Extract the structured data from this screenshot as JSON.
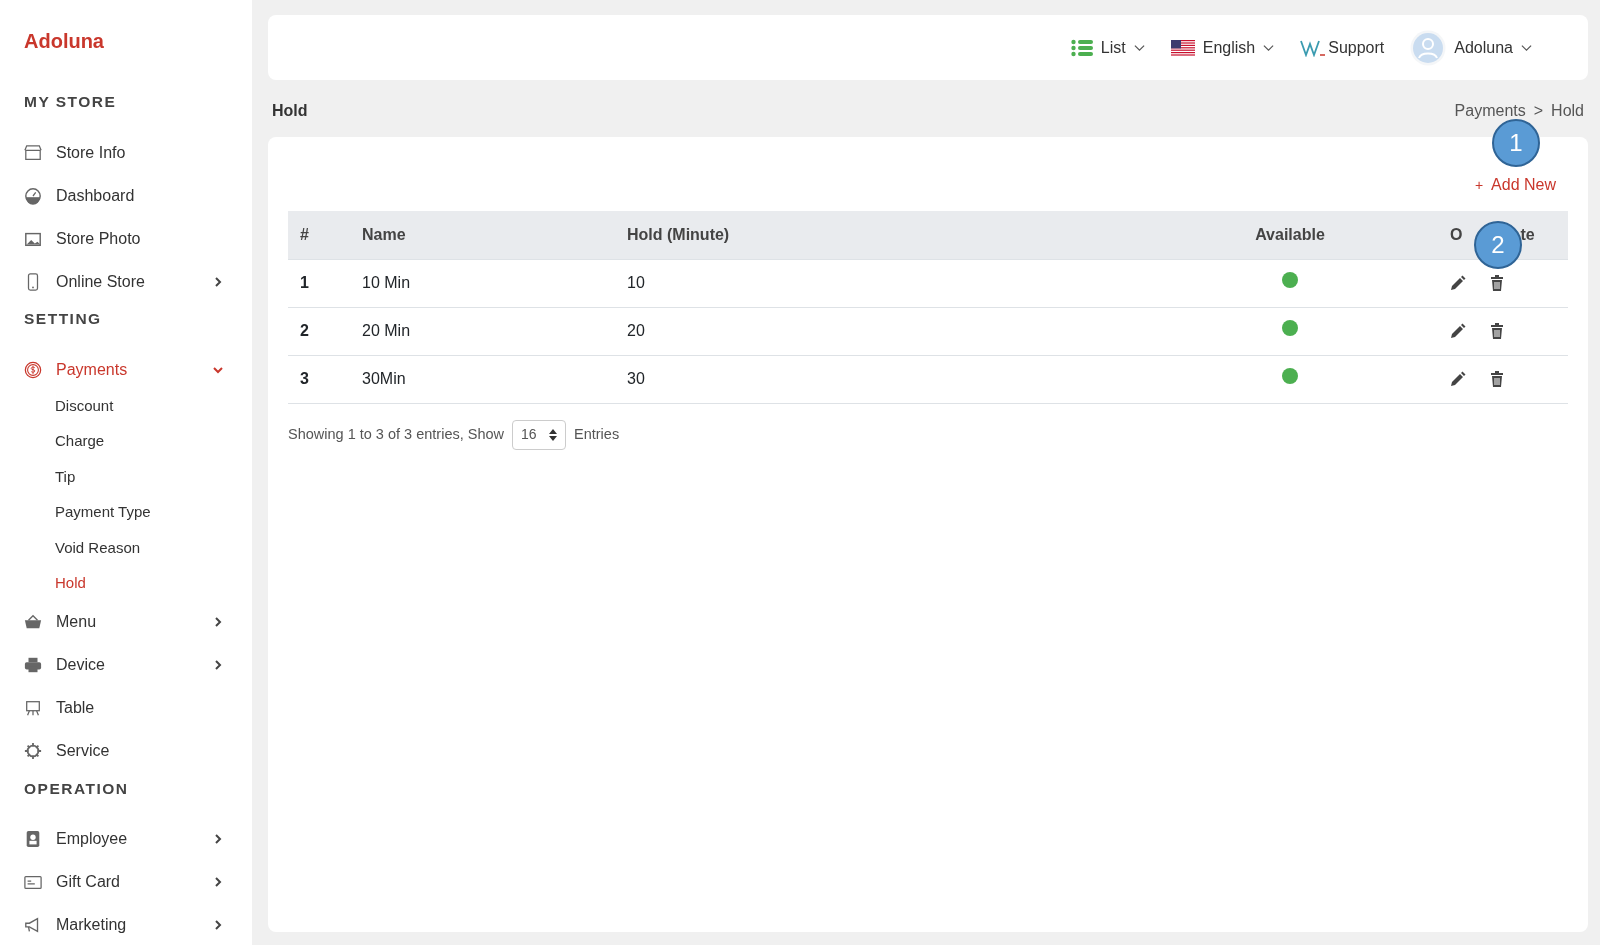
{
  "brand": "Adoluna",
  "sidebar": {
    "sections": [
      {
        "title": "MY STORE",
        "items": [
          {
            "label": "Store Info",
            "selected": false
          },
          {
            "label": "Dashboard",
            "selected": false
          },
          {
            "label": "Store Photo",
            "selected": false
          },
          {
            "label": "Online Store",
            "expanded": false,
            "selected": false
          }
        ]
      },
      {
        "title": "SETTING",
        "items": [
          {
            "label": "Payments",
            "expanded": true,
            "selected": true,
            "children": [
              {
                "label": "Discount",
                "selected": false
              },
              {
                "label": "Charge",
                "selected": false
              },
              {
                "label": "Tip",
                "selected": false
              },
              {
                "label": "Payment Type",
                "selected": false
              },
              {
                "label": "Void Reason",
                "selected": false
              },
              {
                "label": "Hold",
                "selected": true
              }
            ]
          },
          {
            "label": "Menu",
            "expanded": false,
            "selected": false
          },
          {
            "label": "Device",
            "expanded": false,
            "selected": false
          },
          {
            "label": "Table",
            "selected": false
          },
          {
            "label": "Service",
            "selected": false
          }
        ]
      },
      {
        "title": "OPERATION",
        "items": [
          {
            "label": "Employee",
            "expanded": false,
            "selected": false
          },
          {
            "label": "Gift Card",
            "expanded": false,
            "selected": false
          },
          {
            "label": "Marketing",
            "expanded": false,
            "selected": false
          }
        ]
      }
    ]
  },
  "topbar": {
    "view": "List",
    "language": "English",
    "support": "Support",
    "user": "Adoluna"
  },
  "page_title": "Hold",
  "breadcrumb": [
    "Payments",
    ">",
    "Hold"
  ],
  "add_button": {
    "icon": "+",
    "label": "Add New"
  },
  "table": {
    "columns": [
      {
        "label": "#"
      },
      {
        "label": "Name"
      },
      {
        "label": "Hold (Minute)"
      },
      {
        "label": "Available"
      },
      {
        "label_start": "O",
        "label_end": "te"
      }
    ],
    "rows": [
      {
        "index": "1",
        "name": "10 Min",
        "minutes": "10",
        "available": true
      },
      {
        "index": "2",
        "name": "20 Min",
        "minutes": "20",
        "available": true
      },
      {
        "index": "3",
        "name": "30Min",
        "minutes": "30",
        "available": true
      }
    ]
  },
  "footer": {
    "showing": "Showing 1 to 3 of 3 entries, Show",
    "page_size": "16",
    "entries": "Entries"
  },
  "callouts": [
    "1",
    "2"
  ]
}
